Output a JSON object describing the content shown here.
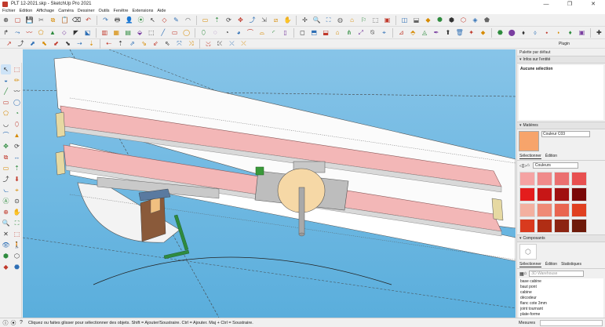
{
  "window": {
    "title": "PLT 12-2021.skp - SketchUp Pro 2021",
    "controls": [
      "—",
      "❐",
      "✕"
    ]
  },
  "menu": [
    "Fichier",
    "Edition",
    "Affichage",
    "Caméra",
    "Dessiner",
    "Outils",
    "Fenêtre",
    "Extensions",
    "Aide"
  ],
  "toolbar_top": [
    "⊕",
    "▢",
    "💾",
    "✂",
    "⧉",
    "📋",
    "⌫",
    "↶",
    "↷",
    "🖶",
    "👤",
    "⦿",
    "↖",
    "◇",
    "✎",
    "◠",
    "▭",
    "⇡",
    "⟳",
    "✥",
    "⤴",
    "⇲",
    "⧄",
    "✋",
    "✢",
    "🔍",
    "⛶",
    "◍",
    "⌂",
    "⚐",
    "⬚",
    "▣",
    "◫",
    "⬓",
    "◆",
    "⯃",
    "⬢",
    "⬡",
    "◈",
    "⬟"
  ],
  "toolbar_mid": [
    "↱",
    "⤳",
    "〰",
    "⬠",
    "▲",
    "⬦",
    "◤",
    "⬕",
    "▥",
    "▦",
    "▤",
    "⬙",
    "⬚",
    "╱",
    "▭",
    "◯",
    "⬯",
    "◌",
    "◔",
    "◕",
    "⌒",
    "⌓",
    "◜",
    "▯",
    "◻",
    "⬒",
    "⬓",
    "⌂",
    "⋔",
    "⤢",
    "⍉",
    "⌖",
    "⊿",
    "⬘",
    "◬",
    "✒",
    "⬆",
    "🗑",
    "✦",
    "⬥",
    "⬣",
    "⬤",
    "⬧",
    "⬨",
    "⬩",
    "⬪",
    "♦",
    "▣",
    "✚"
  ],
  "toolbar_bot": [
    "↗",
    "⤴",
    "⬈",
    "⬉",
    "⬋",
    "⬊",
    "⇢",
    "⇣",
    "⇠",
    "⇡",
    "⇗",
    "⇘",
    "⇙",
    "⇖",
    "⤧",
    "⤨",
    "⤩",
    "⤪",
    "⤫",
    "⤬"
  ],
  "plugin_label": "Plugin",
  "left_tools": [
    "↖",
    "⬚",
    "◒",
    "✏",
    "╱",
    "〰",
    "▭",
    "◯",
    "⬠",
    "◔",
    "◡",
    "⬯",
    "⌒",
    "▲",
    "✥",
    "⟳",
    "⧉",
    "↔",
    "▭",
    "⇡",
    "⤴",
    "⬇",
    "⦦",
    "⌖",
    "Ⓐ",
    "⊙",
    "⊕",
    "✋",
    "🔍",
    "⛶",
    "✕",
    "⬚",
    "👁",
    "🚶",
    "⬢",
    "⬡",
    "◆",
    "⬣"
  ],
  "right_panel": {
    "header": "Palette par défaut",
    "entity_section": "Infos sur l'entité",
    "entity_text": "Aucune sélection",
    "materials_section": "Matières",
    "material_name": "Couleur C03",
    "material_color": "#f7a46b",
    "mat_tabs": [
      "Sélectionner",
      "Édition"
    ],
    "mat_library": "Couleurs",
    "swatches": [
      "#f5a3a3",
      "#f08a8a",
      "#eb6f6f",
      "#e85050",
      "#e41d1d",
      "#c71616",
      "#a01010",
      "#7a0808",
      "#f3b0a0",
      "#ef8a76",
      "#e96550",
      "#e04020",
      "#d93a1e",
      "#b02d14",
      "#8c2412",
      "#6e1a0a"
    ],
    "components_section": "Composants",
    "comp_tabs": [
      "Sélectionner",
      "Édition",
      "Statistiques"
    ],
    "comp_search": "3D Warehouse",
    "components": [
      "base cabine",
      "baut pont",
      "cabine",
      "décodeur",
      "flanc cote 3mm",
      "joint tournant",
      "plate-forme"
    ]
  },
  "status": {
    "text": "Cliquez ou faites glisser pour sélectionner des objets. Shift = Ajouter/Soustraire. Ctrl = Ajouter. Maj + Ctrl = Soustraire.",
    "measure_label": "Mesures",
    "icons": [
      "ⓘ",
      "⦿",
      "?"
    ]
  }
}
